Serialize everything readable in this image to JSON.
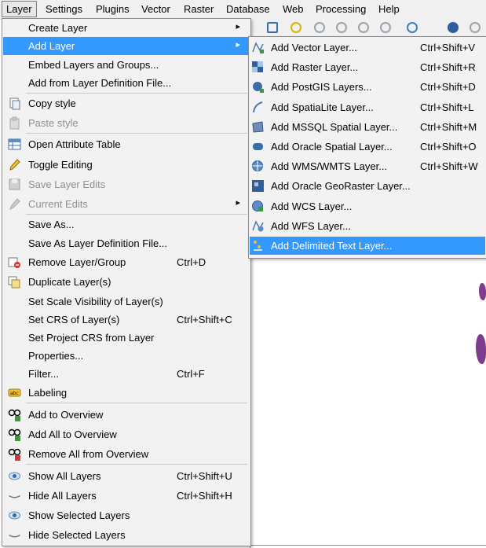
{
  "menubar": {
    "items": [
      "Layer",
      "Settings",
      "Plugins",
      "Vector",
      "Raster",
      "Database",
      "Web",
      "Processing",
      "Help"
    ]
  },
  "layer_menu": {
    "items": [
      {
        "label": "Create Layer",
        "shortcut": "",
        "submenu": true
      },
      {
        "label": "Add Layer",
        "shortcut": "",
        "submenu": true
      },
      {
        "label": "Embed Layers and Groups...",
        "shortcut": ""
      },
      {
        "label": "Add from Layer Definition File...",
        "shortcut": ""
      },
      {
        "label": "Copy style",
        "shortcut": "",
        "icon": "copy-style-icon"
      },
      {
        "label": "Paste style",
        "shortcut": "",
        "icon": "paste-style-icon"
      },
      {
        "label": "Open Attribute Table",
        "shortcut": "",
        "icon": "attribute-table-icon"
      },
      {
        "label": "Toggle Editing",
        "shortcut": "",
        "icon": "pencil-icon"
      },
      {
        "label": "Save Layer Edits",
        "shortcut": "",
        "icon": "save-edits-icon"
      },
      {
        "label": "Current Edits",
        "shortcut": "",
        "submenu": true,
        "icon": "current-edits-icon"
      },
      {
        "label": "Save As...",
        "shortcut": ""
      },
      {
        "label": "Save As Layer Definition File...",
        "shortcut": ""
      },
      {
        "label": "Remove Layer/Group",
        "shortcut": "Ctrl+D",
        "icon": "remove-layer-icon"
      },
      {
        "label": "Duplicate Layer(s)",
        "shortcut": "",
        "icon": "duplicate-layer-icon"
      },
      {
        "label": "Set Scale Visibility of Layer(s)",
        "shortcut": ""
      },
      {
        "label": "Set CRS of Layer(s)",
        "shortcut": "Ctrl+Shift+C"
      },
      {
        "label": "Set Project CRS from Layer",
        "shortcut": ""
      },
      {
        "label": "Properties...",
        "shortcut": ""
      },
      {
        "label": "Filter...",
        "shortcut": "Ctrl+F"
      },
      {
        "label": "Labeling",
        "shortcut": "",
        "icon": "labeling-icon"
      },
      {
        "label": "Add to Overview",
        "shortcut": "",
        "icon": "add-overview-icon"
      },
      {
        "label": "Add All to Overview",
        "shortcut": "",
        "icon": "add-all-overview-icon"
      },
      {
        "label": "Remove All from Overview",
        "shortcut": "",
        "icon": "remove-overview-icon"
      },
      {
        "label": "Show All Layers",
        "shortcut": "Ctrl+Shift+U",
        "icon": "eye-icon"
      },
      {
        "label": "Hide All Layers",
        "shortcut": "Ctrl+Shift+H",
        "icon": "eye-closed-icon"
      },
      {
        "label": "Show Selected Layers",
        "shortcut": "",
        "icon": "eye-icon"
      },
      {
        "label": "Hide Selected Layers",
        "shortcut": "",
        "icon": "eye-closed-icon"
      }
    ]
  },
  "add_layer_submenu": {
    "items": [
      {
        "label": "Add Vector Layer...",
        "shortcut": "Ctrl+Shift+V",
        "icon": "vector-layer-icon"
      },
      {
        "label": "Add Raster Layer...",
        "shortcut": "Ctrl+Shift+R",
        "icon": "raster-layer-icon"
      },
      {
        "label": "Add PostGIS Layers...",
        "shortcut": "Ctrl+Shift+D",
        "icon": "postgis-icon"
      },
      {
        "label": "Add SpatiaLite Layer...",
        "shortcut": "Ctrl+Shift+L",
        "icon": "spatialite-icon"
      },
      {
        "label": "Add MSSQL Spatial Layer...",
        "shortcut": "Ctrl+Shift+M",
        "icon": "mssql-icon"
      },
      {
        "label": "Add Oracle Spatial Layer...",
        "shortcut": "Ctrl+Shift+O",
        "icon": "oracle-icon"
      },
      {
        "label": "Add WMS/WMTS Layer...",
        "shortcut": "Ctrl+Shift+W",
        "icon": "wms-icon"
      },
      {
        "label": "Add Oracle GeoRaster Layer...",
        "shortcut": "",
        "icon": "georaster-icon"
      },
      {
        "label": "Add WCS Layer...",
        "shortcut": "",
        "icon": "wcs-icon"
      },
      {
        "label": "Add WFS Layer...",
        "shortcut": "",
        "icon": "wfs-icon"
      },
      {
        "label": "Add Delimited Text Layer...",
        "shortcut": "",
        "icon": "delimited-text-icon"
      }
    ]
  },
  "colors": {
    "highlight": "#3399ff",
    "menu_bg": "#f2f2f2",
    "disabled": "#8f8f8f"
  }
}
